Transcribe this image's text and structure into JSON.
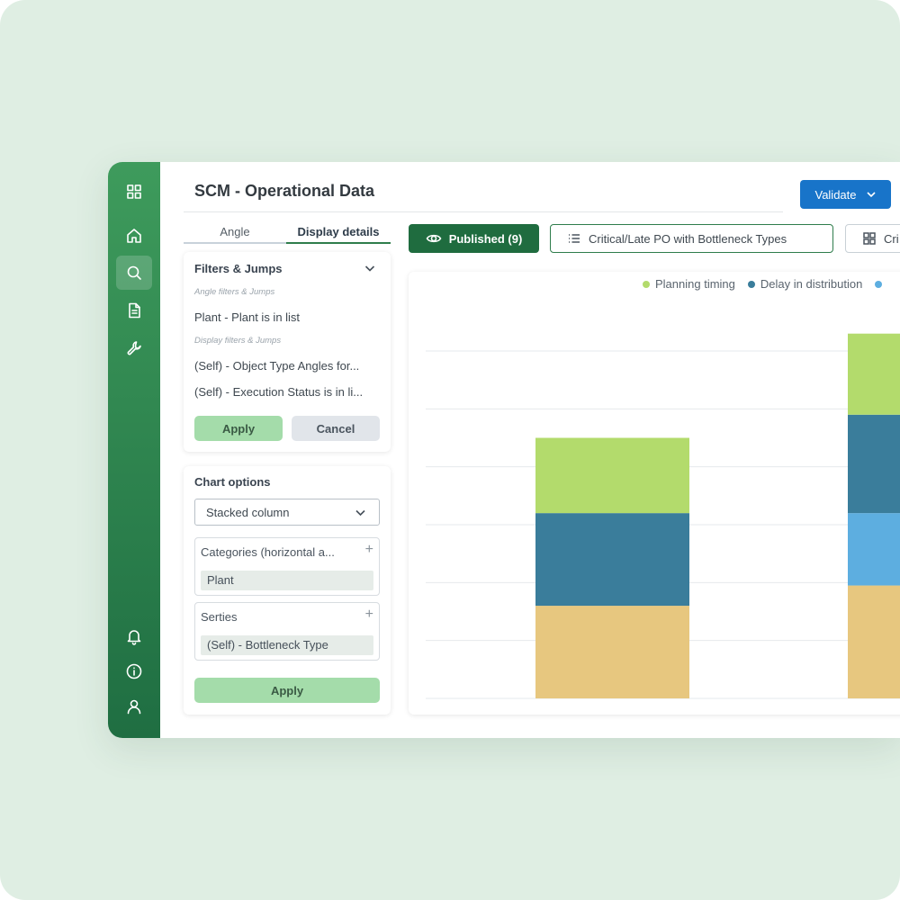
{
  "app": {
    "title": "SCM - Operational Data",
    "validate_label": "Validate"
  },
  "sidebar": {
    "top_items": [
      {
        "icon": "grid-icon"
      },
      {
        "icon": "home-icon"
      },
      {
        "icon": "search-icon",
        "active": true
      },
      {
        "icon": "document-icon"
      },
      {
        "icon": "wrench-icon"
      }
    ],
    "bottom_items": [
      {
        "icon": "bell-icon"
      },
      {
        "icon": "info-icon"
      },
      {
        "icon": "user-icon"
      }
    ]
  },
  "tabs": {
    "angle": "Angle",
    "display_details": "Display details",
    "active": "display_details"
  },
  "filters": {
    "title": "Filters & Jumps",
    "angle_hint": "Angle filters & Jumps",
    "angle_items": [
      "Plant - Plant is in list"
    ],
    "display_hint": "Display filters & Jumps",
    "display_items": [
      "(Self) - Object Type Angles for...",
      "(Self) - Execution Status is in li..."
    ],
    "apply_label": "Apply",
    "cancel_label": "Cancel"
  },
  "chart_options": {
    "title": "Chart options",
    "chart_type": "Stacked column",
    "categories_label": "Categories (horizontal a...",
    "categories_value": "Plant",
    "series_label": "Serties",
    "series_value": "(Self) - Bottleneck Type",
    "apply_label": "Apply"
  },
  "toolbar": {
    "published_label": "Published (9)",
    "view_label": "Critical/Late PO with Bottleneck Types",
    "grid_label": "Cri"
  },
  "colors": {
    "accent": "#1f6c3f",
    "validate": "#1874c9",
    "planning_timing": "#b3db6c",
    "delay_in_distribution": "#3a7d9b",
    "light_blue": "#5daee0",
    "tan": "#e7c77f"
  },
  "chart_data": {
    "type": "bar",
    "stacked": true,
    "legend": [
      "Planning timing",
      "Delay in distribution"
    ],
    "legend_placement": "top-right",
    "grid": true,
    "ylim": [
      0,
      6
    ],
    "series": [
      {
        "values": [
          1.6,
          1.95
        ],
        "color": "#e7c77f"
      },
      {
        "values": [
          0,
          1.25
        ],
        "color": "#5daee0"
      },
      {
        "name": "Delay in distribution",
        "values": [
          1.6,
          1.7
        ],
        "color": "#3a7d9b"
      },
      {
        "name": "Planning timing",
        "values": [
          1.3,
          1.4
        ],
        "color": "#b3db6c"
      }
    ]
  }
}
